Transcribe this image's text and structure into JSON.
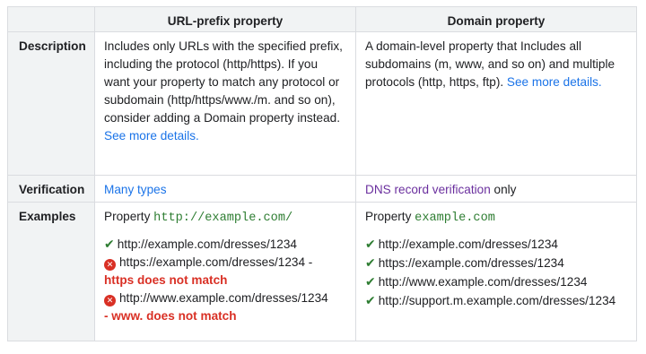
{
  "table": {
    "headers": {
      "corner": "",
      "url_prefix": "URL-prefix property",
      "domain": "Domain property"
    },
    "description": {
      "label": "Description",
      "url_prefix": {
        "text": "Includes only URLs with the specified prefix, including the protocol (http/https). If you want your property to match any protocol or subdomain (http/https/www./m. and so on), consider adding a Domain property instead.",
        "link": "See more details."
      },
      "domain": {
        "text": "A domain-level property that Includes all subdomains (m, www, and so on) and multiple protocols (http, https, ftp).",
        "link": "See more details."
      }
    },
    "verification": {
      "label": "Verification",
      "url_prefix": {
        "link": "Many types"
      },
      "domain": {
        "link": "DNS record verification",
        "suffix": "only"
      }
    },
    "examples": {
      "label": "Examples",
      "url_prefix": {
        "property_label": "Property",
        "property_value": "http://example.com/",
        "items": [
          {
            "status": "match",
            "url": "http://example.com/dresses/1234"
          },
          {
            "status": "no-match",
            "url": "https://example.com/dresses/1234 -",
            "reason": "https does not match"
          },
          {
            "status": "no-match",
            "url": "http://www.example.com/dresses/1234",
            "reason": "- www. does not match"
          }
        ]
      },
      "domain": {
        "property_label": "Property",
        "property_value": "example.com",
        "items": [
          {
            "status": "match",
            "url": "http://example.com/dresses/1234"
          },
          {
            "status": "match",
            "url": "https://example.com/dresses/1234"
          },
          {
            "status": "match",
            "url": "http://www.example.com/dresses/1234"
          },
          {
            "status": "match",
            "url": "http://support.m.example.com/dresses/1234"
          }
        ]
      }
    }
  },
  "icons": {
    "match": "check-mark-icon",
    "no_match": "error-x-icon"
  },
  "colors": {
    "link": "#1a73e8",
    "visited_link": "#6a2f9e",
    "code": "#2e7d32",
    "error": "#d93025",
    "header_bg": "#f1f3f4",
    "border": "#dadce0"
  }
}
